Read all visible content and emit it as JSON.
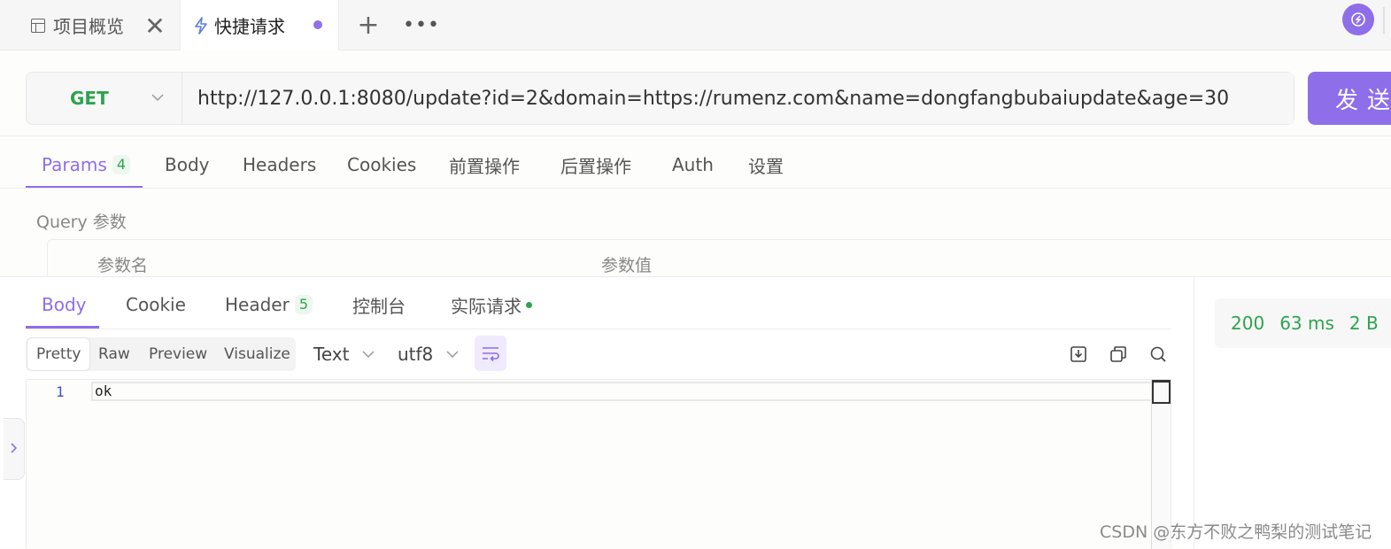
{
  "tabs": [
    {
      "label": "项目概览"
    },
    {
      "label": "快捷请求"
    }
  ],
  "request": {
    "method": "GET",
    "url": "http://127.0.0.1:8080/update?id=2&domain=https://rumenz.com&name=dongfangbubaiupdate&age=30",
    "send_label": "发送"
  },
  "request_tabs": [
    {
      "label": "Params",
      "count": "4"
    },
    {
      "label": "Body"
    },
    {
      "label": "Headers"
    },
    {
      "label": "Cookies"
    },
    {
      "label": "前置操作"
    },
    {
      "label": "后置操作"
    },
    {
      "label": "Auth"
    },
    {
      "label": "设置"
    }
  ],
  "query": {
    "title": "Query 参数",
    "columns": [
      "参数名",
      "参数值"
    ]
  },
  "response_tabs": [
    {
      "label": "Body"
    },
    {
      "label": "Cookie"
    },
    {
      "label": "Header",
      "count": "5"
    },
    {
      "label": "控制台"
    },
    {
      "label": "实际请求"
    }
  ],
  "format_buttons": [
    "Pretty",
    "Raw",
    "Preview",
    "Visualize"
  ],
  "dropdowns": {
    "type": "Text",
    "encoding": "utf8"
  },
  "response": {
    "line_number": "1",
    "body": "ok",
    "status": "200",
    "time": "63 ms",
    "size": "2 B"
  },
  "watermark": "CSDN @东方不败之鸭梨的测试笔记",
  "colors": {
    "accent": "#8f6eea",
    "success": "#2da44e"
  },
  "icons": [
    "layout-icon",
    "close-icon",
    "bolt-icon",
    "plus-icon",
    "more-icon",
    "sync-icon",
    "chevron-down-icon",
    "wrap-icon",
    "download-icon",
    "copy-icon",
    "search-icon",
    "chevron-right-icon"
  ]
}
